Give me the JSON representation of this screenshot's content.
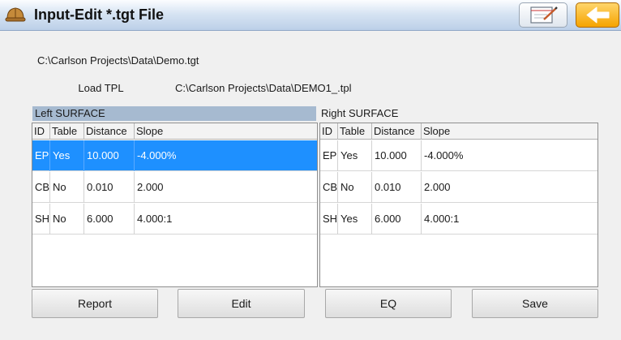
{
  "window": {
    "title": "Input-Edit *.tgt File"
  },
  "paths": {
    "tgt_path": "C:\\Carlson Projects\\Data\\Demo.tgt",
    "tpl_path": "C:\\Carlson Projects\\Data\\DEMO1_.tpl"
  },
  "buttons": {
    "load_tpl": "Load TPL",
    "report": "Report",
    "edit": "Edit",
    "eq": "EQ",
    "save": "Save"
  },
  "columns": [
    "ID",
    "Table",
    "Distance",
    "Slope"
  ],
  "left_surface": {
    "caption": "Left SURFACE",
    "rows": [
      {
        "id": "EP",
        "table": "Yes",
        "distance": "10.000",
        "slope": "-4.000%"
      },
      {
        "id": "CB",
        "table": "No",
        "distance": "0.010",
        "slope": "2.000"
      },
      {
        "id": "SH",
        "table": "No",
        "distance": "6.000",
        "slope": "4.000:1"
      }
    ]
  },
  "right_surface": {
    "caption": "Right SURFACE",
    "rows": [
      {
        "id": "EP",
        "table": "Yes",
        "distance": "10.000",
        "slope": "-4.000%"
      },
      {
        "id": "CB",
        "table": "No",
        "distance": "0.010",
        "slope": "2.000"
      },
      {
        "id": "SH",
        "table": "Yes",
        "distance": "6.000",
        "slope": "4.000:1"
      }
    ]
  },
  "colors": {
    "selection": "#1e90ff",
    "left_caption_bg": "#a6bad0",
    "back_button": "#f5a300"
  },
  "icons": {
    "app": "hard-hat-icon",
    "notes": "notepad-pencil-icon",
    "back": "back-arrow-icon"
  }
}
